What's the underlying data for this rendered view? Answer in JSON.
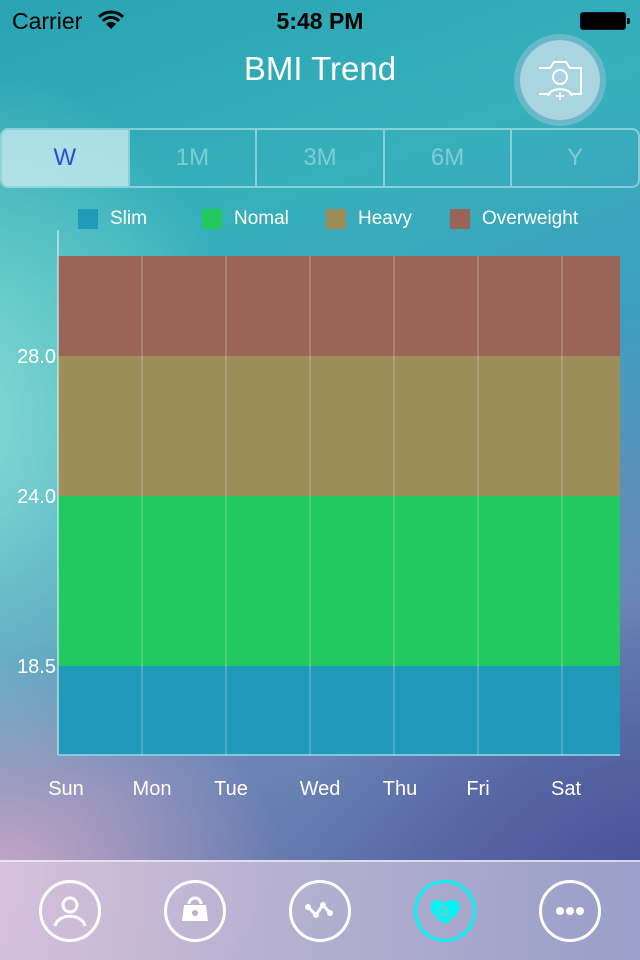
{
  "status_bar": {
    "carrier": "Carrier",
    "time": "5:48 PM",
    "wifi_icon": "wifi-icon",
    "battery_icon": "battery-icon"
  },
  "header": {
    "title": "BMI Trend",
    "camera_button_icon": "camera-add-user-icon"
  },
  "segments": [
    {
      "label": "W",
      "active": true
    },
    {
      "label": "1M",
      "active": false
    },
    {
      "label": "3M",
      "active": false
    },
    {
      "label": "6M",
      "active": false
    },
    {
      "label": "Y",
      "active": false
    }
  ],
  "tabbar": [
    {
      "name": "profile",
      "icon": "user-icon",
      "active": false
    },
    {
      "name": "shop",
      "icon": "bag-icon",
      "active": false
    },
    {
      "name": "trend",
      "icon": "trend-line-icon",
      "active": false
    },
    {
      "name": "health",
      "icon": "heart-search-icon",
      "active": true
    },
    {
      "name": "more",
      "icon": "more-dots-icon",
      "active": false
    }
  ],
  "chart_data": {
    "type": "area",
    "title": "BMI Trend",
    "categories": [
      "Sun",
      "Mon",
      "Tue",
      "Wed",
      "Thu",
      "Fri",
      "Sat"
    ],
    "y_ticks": [
      "18.5",
      "24.0",
      "28.0"
    ],
    "bands": [
      {
        "name": "Slim",
        "from": null,
        "to": 18.5,
        "color": "#2199b8"
      },
      {
        "name": "Nomal",
        "from": 18.5,
        "to": 24.0,
        "color": "#22c95e"
      },
      {
        "name": "Heavy",
        "from": 24.0,
        "to": 28.0,
        "color": "#9c8d59"
      },
      {
        "name": "Overweight",
        "from": 28.0,
        "to": null,
        "color": "#9a6558"
      }
    ],
    "legend": [
      "Slim",
      "Nomal",
      "Heavy",
      "Overweight"
    ],
    "legend_position": "top",
    "grid": true,
    "series": []
  },
  "colors": {
    "accent_active_tab": "#00f5f5",
    "segment_active_text": "#2a4fd0"
  }
}
